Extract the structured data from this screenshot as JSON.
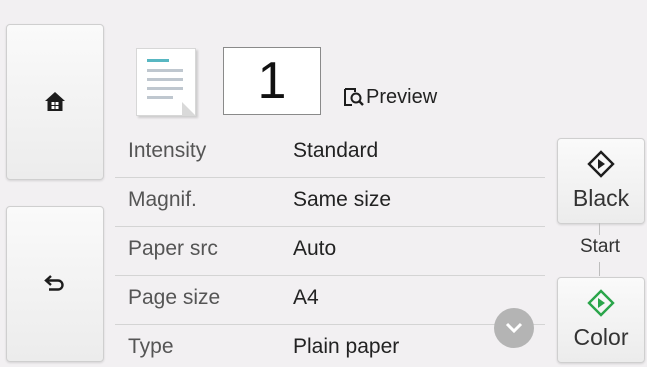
{
  "header": {
    "copies": "1",
    "preview_label": "Preview"
  },
  "settings": [
    {
      "label": "Intensity",
      "value": "Standard"
    },
    {
      "label": "Magnif.",
      "value": "Same size"
    },
    {
      "label": "Paper src",
      "value": "Auto"
    },
    {
      "label": "Page size",
      "value": "A4"
    },
    {
      "label": "Type",
      "value": "Plain paper"
    }
  ],
  "start": {
    "black_label": "Black",
    "start_label": "Start",
    "color_label": "Color"
  },
  "colors": {
    "color_accent": "#2aa54a",
    "doc_accent": "#58b7c2"
  },
  "icons": {
    "home": "home-icon",
    "back": "back-arrow-icon",
    "preview": "preview-icon",
    "scroll": "chevron-down-icon",
    "start": "start-diamond-icon"
  }
}
